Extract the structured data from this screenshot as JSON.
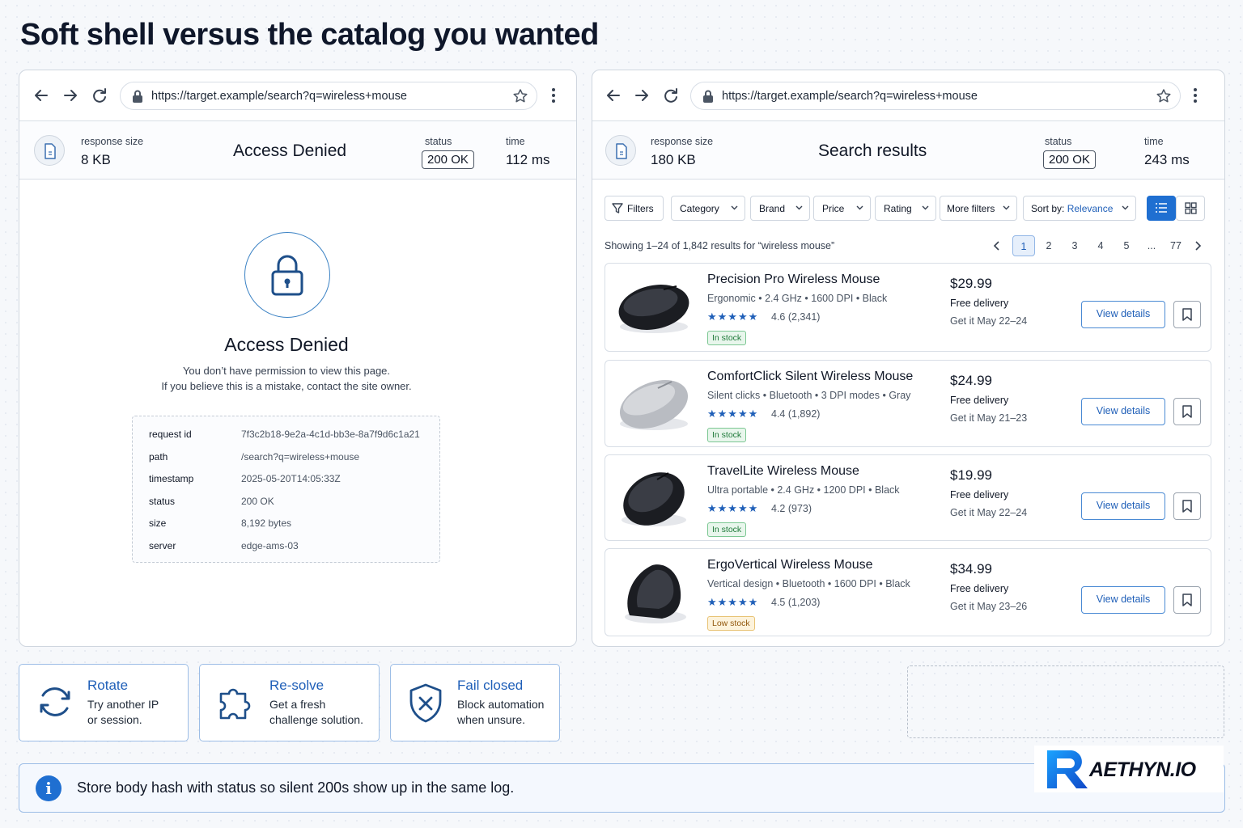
{
  "title": "Soft shell versus the catalog you wanted",
  "left": {
    "url": "https://target.example/search?q=wireless+mouse",
    "stats": {
      "size_label": "response size",
      "size_value": "8 KB",
      "heading": "Access Denied",
      "status_label": "status",
      "status_value": "200 OK",
      "time_label": "time",
      "time_value": "112 ms"
    },
    "denied_title": "Access Denied",
    "denied_line1": "You don’t have permission to view this page.",
    "denied_line2": "If you believe this is a mistake, contact the site owner.",
    "details": [
      {
        "key": "request id",
        "value": "7f3c2b18-9e2a-4c1d-bb3e-8a7f9d6c1a21"
      },
      {
        "key": "path",
        "value": "/search?q=wireless+mouse"
      },
      {
        "key": "timestamp",
        "value": "2025-05-20T14:05:33Z"
      },
      {
        "key": "status",
        "value": "200 OK"
      },
      {
        "key": "size",
        "value": "8,192 bytes"
      },
      {
        "key": "server",
        "value": "edge-ams-03"
      }
    ]
  },
  "right": {
    "url": "https://target.example/search?q=wireless+mouse",
    "stats": {
      "size_label": "response size",
      "size_value": "180 KB",
      "heading": "Search results",
      "status_label": "status",
      "status_value": "200 OK",
      "time_label": "time",
      "time_value": "243 ms"
    },
    "filters": [
      "Filters",
      "Category",
      "Brand",
      "Price",
      "Rating",
      "More filters"
    ],
    "sort_prefix": "Sort by: ",
    "sort_value": "Relevance",
    "results_summary": "Showing 1–24 of 1,842 results for “wireless mouse”",
    "pages": [
      "1",
      "2",
      "3",
      "4",
      "5",
      "...",
      "77"
    ],
    "current_page": "1",
    "products": [
      {
        "name": "Precision Pro Wireless Mouse",
        "specs": "Ergonomic  •  2.4 GHz  •  1600 DPI  •  Black",
        "stars": "★★★★★",
        "rating": "4.6 (2,341)",
        "stock": "In stock",
        "price": "$29.99",
        "delivery": "Free delivery",
        "eta": "Get it May 22–24",
        "view": "View details"
      },
      {
        "name": "ComfortClick Silent Wireless Mouse",
        "specs": "Silent clicks  •  Bluetooth  •  3 DPI modes  •  Gray",
        "stars": "★★★★★",
        "rating": "4.4 (1,892)",
        "stock": "In stock",
        "price": "$24.99",
        "delivery": "Free delivery",
        "eta": "Get it May 21–23",
        "view": "View details"
      },
      {
        "name": "TravelLite Wireless Mouse",
        "specs": "Ultra portable  •  2.4 GHz  •  1200 DPI  •  Black",
        "stars": "★★★★★",
        "rating": "4.2 (973)",
        "stock": "In stock",
        "price": "$19.99",
        "delivery": "Free delivery",
        "eta": "Get it May 22–24",
        "view": "View details"
      },
      {
        "name": "ErgoVertical Wireless Mouse",
        "specs": "Vertical design  •  Bluetooth  •  1600 DPI  •  Black",
        "stars": "★★★★★",
        "rating": "4.5 (1,203)",
        "stock": "Low stock",
        "price": "$34.99",
        "delivery": "Free delivery",
        "eta": "Get it May 23–26",
        "view": "View details"
      }
    ]
  },
  "actions": [
    {
      "title": "Rotate",
      "desc1": "Try another IP",
      "desc2": "or session.",
      "icon": "rotate-icon"
    },
    {
      "title": "Re-solve",
      "desc1": "Get a fresh",
      "desc2": "challenge solution.",
      "icon": "puzzle-icon"
    },
    {
      "title": "Fail closed",
      "desc1": "Block automation",
      "desc2": "when unsure.",
      "icon": "shield-x-icon"
    }
  ],
  "tip": "Store body hash with status so silent 200s show up in the same log.",
  "logo": "AETHYN.IO",
  "colors": {
    "accent": "#1f5fb8",
    "border": "#cfd6df",
    "stock_in": "#1f7a3a",
    "stock_low": "#92580e"
  }
}
